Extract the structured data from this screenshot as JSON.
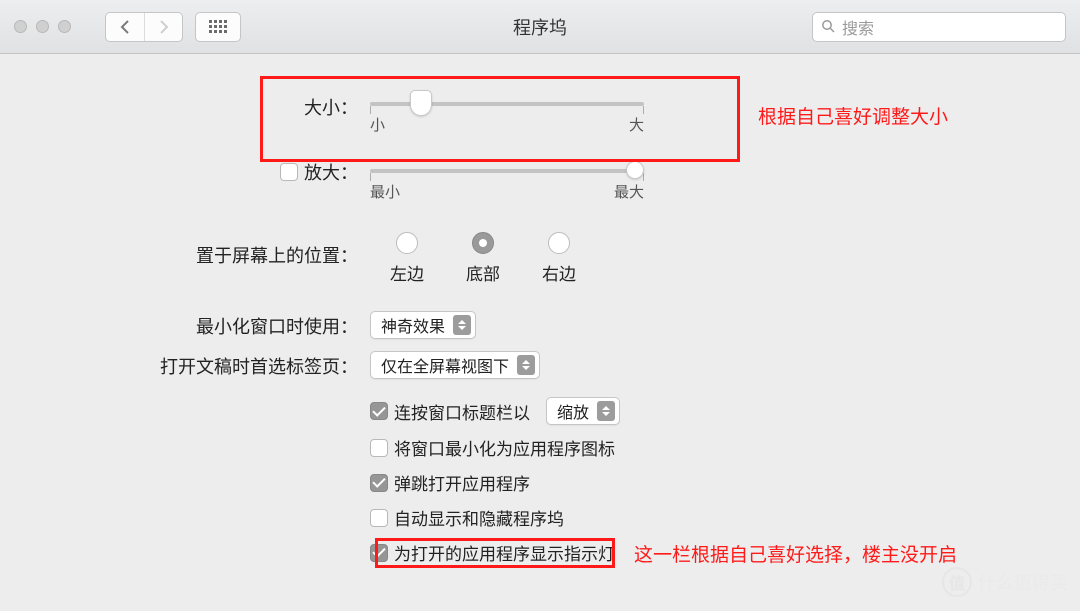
{
  "title": "程序坞",
  "search_placeholder": "搜索",
  "size": {
    "label": "大小：",
    "min": "小",
    "max": "大",
    "value_pct": 18
  },
  "magnify": {
    "label": "放大：",
    "checked": false,
    "min": "最小",
    "max": "最大",
    "value_pct": 96
  },
  "position": {
    "label": "置于屏幕上的位置：",
    "options": [
      "左边",
      "底部",
      "右边"
    ],
    "selected_index": 1
  },
  "minimize_effect": {
    "label": "最小化窗口时使用：",
    "value": "神奇效果"
  },
  "tabs_pref": {
    "label": "打开文稿时首选标签页：",
    "value": "仅在全屏幕视图下"
  },
  "doubleclick": {
    "checked": true,
    "label": "连按窗口标题栏以",
    "value": "缩放"
  },
  "checks": [
    {
      "checked": false,
      "label": "将窗口最小化为应用程序图标"
    },
    {
      "checked": true,
      "label": "弹跳打开应用程序"
    },
    {
      "checked": false,
      "label": "自动显示和隐藏程序坞"
    },
    {
      "checked": true,
      "label": "为打开的应用程序显示指示灯"
    }
  ],
  "annotations": {
    "a1": "根据自己喜好调整大小",
    "a2": "这一栏根据自己喜好选择，楼主没开启"
  },
  "watermark": {
    "icon": "值",
    "text": "什么值得买"
  }
}
